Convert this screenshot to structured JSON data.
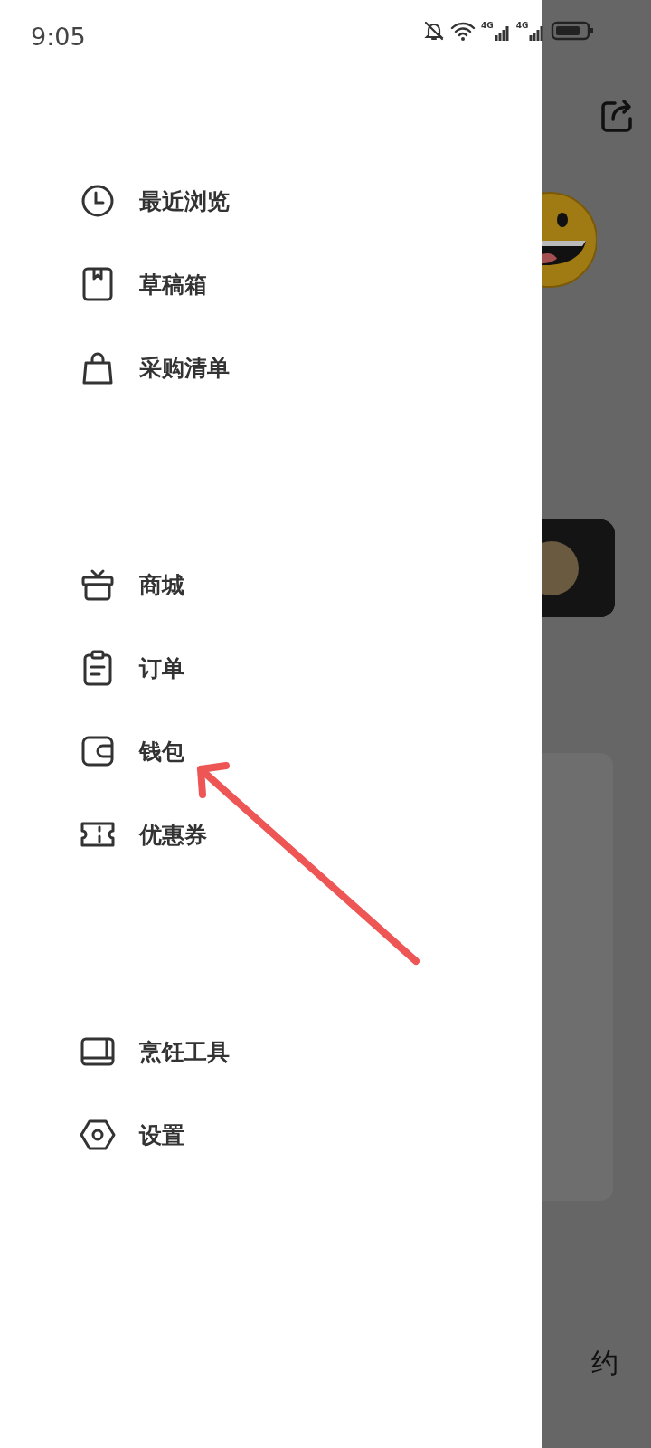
{
  "status_bar": {
    "time": "9:05",
    "network_1": "4G",
    "network_2": "4G"
  },
  "drawer": {
    "groups": [
      {
        "items": [
          {
            "label": "最近浏览"
          },
          {
            "label": "草稿箱"
          },
          {
            "label": "采购清单"
          }
        ]
      },
      {
        "items": [
          {
            "label": "商城"
          },
          {
            "label": "订单"
          },
          {
            "label": "钱包"
          },
          {
            "label": "优惠券"
          }
        ]
      },
      {
        "items": [
          {
            "label": "烹饪工具"
          },
          {
            "label": "设置"
          }
        ]
      }
    ]
  },
  "background_page": {
    "bottom_text": "约"
  }
}
